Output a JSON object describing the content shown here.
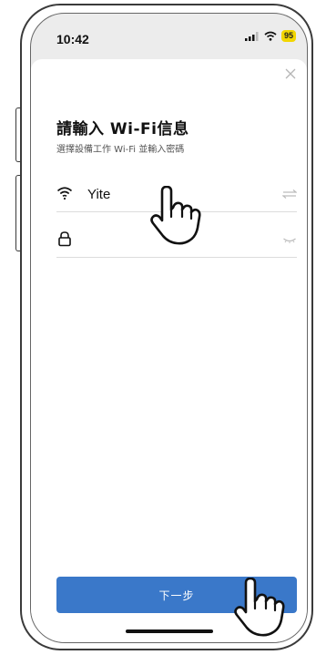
{
  "status_bar": {
    "time": "10:42",
    "battery": "95",
    "battery_color": "#f2d600"
  },
  "dialog": {
    "title": "請輸入 Wi-Fi信息",
    "subtitle": "選擇設備工作 Wi-Fi 並輸入密碼",
    "close_icon": "close-icon"
  },
  "wifi_row": {
    "icon": "wifi-icon",
    "ssid": "Yite",
    "action_icon": "switch-network-icon"
  },
  "password_row": {
    "icon": "lock-icon",
    "value": "",
    "action_icon": "eye-closed-icon"
  },
  "next_button": {
    "label": "下一步",
    "color": "#3a78c9"
  }
}
